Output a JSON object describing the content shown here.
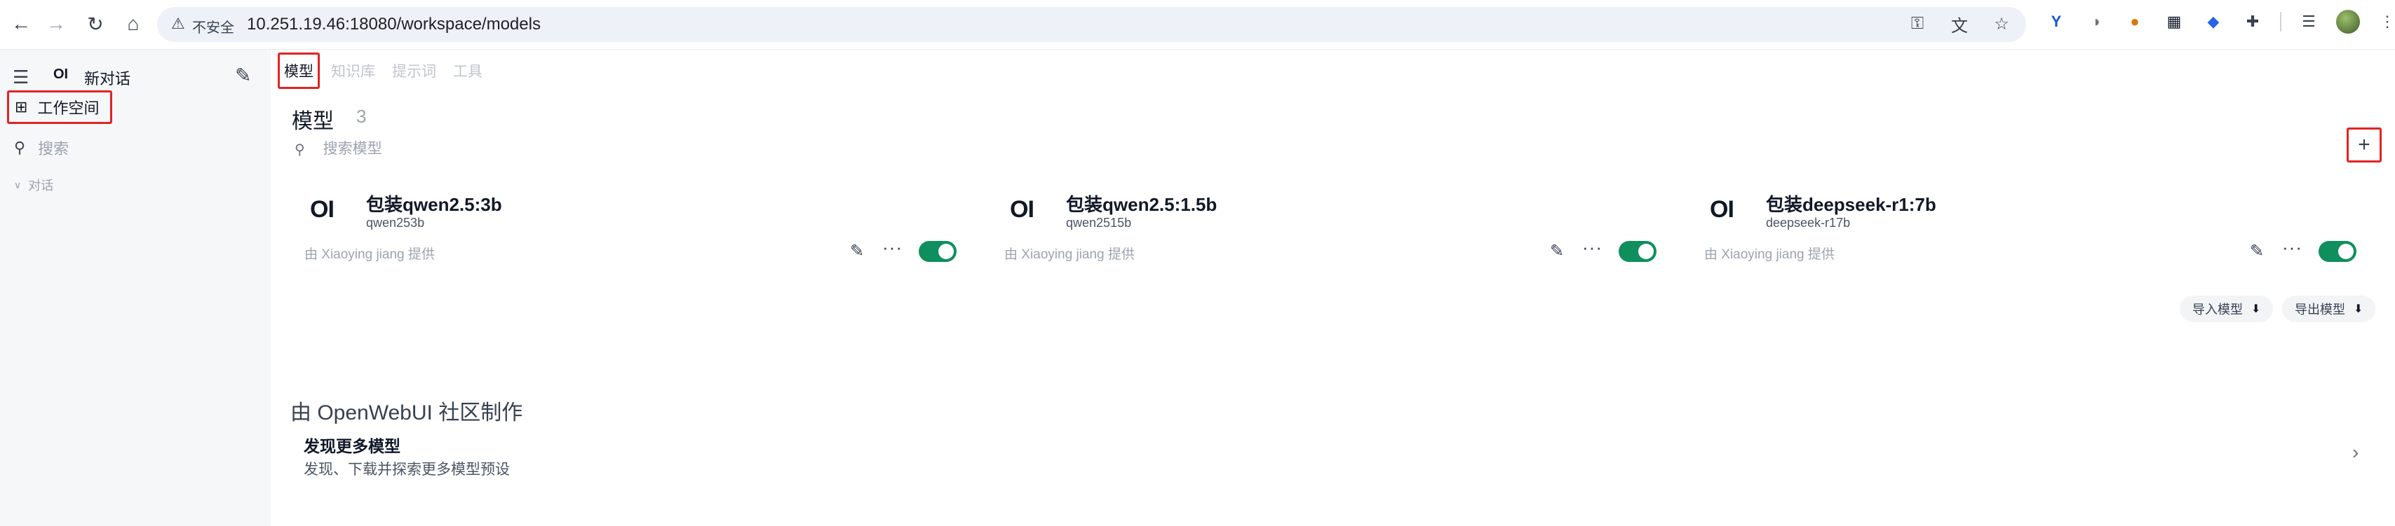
{
  "browser": {
    "insecure_label": "不安全",
    "url": "10.251.19.46:18080/workspace/models"
  },
  "sidebar": {
    "logo_text": "OI",
    "new_chat": "新对话",
    "workspace": "工作空间",
    "search_placeholder": "搜索",
    "chats_section": "对话"
  },
  "tabs": [
    "模型",
    "知识库",
    "提示词",
    "工具"
  ],
  "header": {
    "title": "模型",
    "count": "3",
    "search_placeholder": "搜索模型"
  },
  "models": [
    {
      "logo": "OI",
      "name": "包装qwen2.5:3b",
      "id": "qwen253b",
      "author": "由 Xiaoying jiang 提供",
      "enabled": true
    },
    {
      "logo": "OI",
      "name": "包装qwen2.5:1.5b",
      "id": "qwen2515b",
      "author": "由 Xiaoying jiang 提供",
      "enabled": true
    },
    {
      "logo": "OI",
      "name": "包装deepseek-r1:7b",
      "id": "deepseek-r17b",
      "author": "由 Xiaoying jiang 提供",
      "enabled": true
    }
  ],
  "actions": {
    "import": "导入模型",
    "export": "导出模型"
  },
  "community": {
    "title": "由 OpenWebUI 社区制作",
    "discover_title": "发现更多模型",
    "discover_subtitle": "发现、下载并探索更多模型预设"
  },
  "colors": {
    "toggle_on": "#0f8f5e",
    "highlight_border": "#e02424"
  }
}
